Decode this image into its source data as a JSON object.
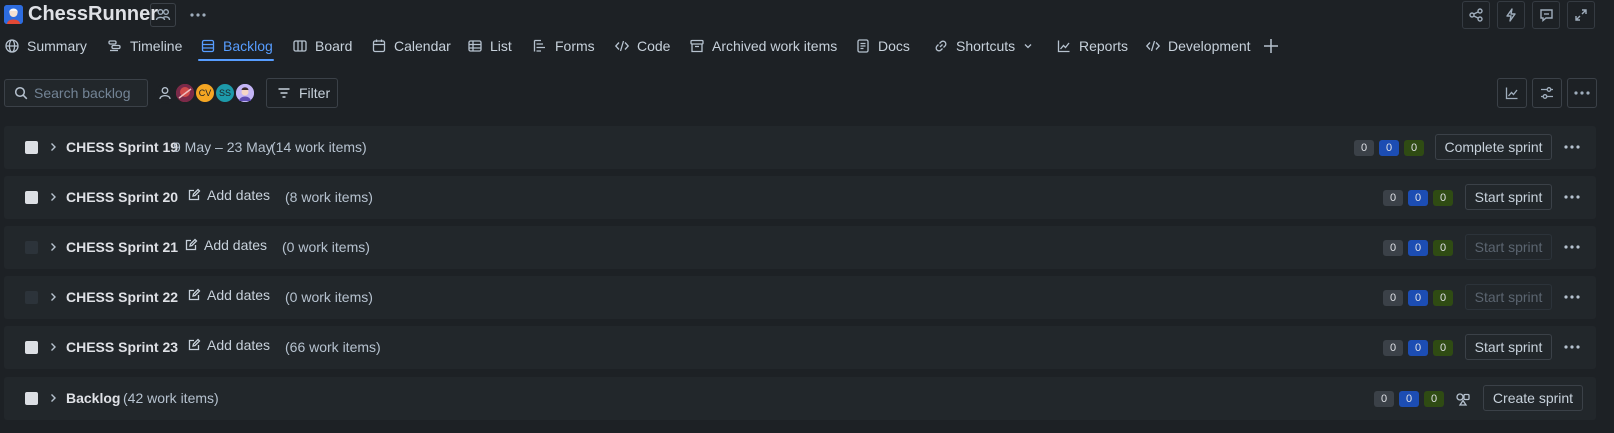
{
  "project": {
    "name": "ChessRunner"
  },
  "tabs": [
    {
      "label": "Summary",
      "icon": "globe-icon"
    },
    {
      "label": "Timeline",
      "icon": "timeline-icon"
    },
    {
      "label": "Backlog",
      "icon": "backlog-icon",
      "active": true
    },
    {
      "label": "Board",
      "icon": "board-icon"
    },
    {
      "label": "Calendar",
      "icon": "calendar-icon"
    },
    {
      "label": "List",
      "icon": "list-icon"
    },
    {
      "label": "Forms",
      "icon": "forms-icon"
    },
    {
      "label": "Code",
      "icon": "code-icon"
    },
    {
      "label": "Archived work items",
      "icon": "archive-icon"
    },
    {
      "label": "Docs",
      "icon": "docs-icon"
    },
    {
      "label": "Shortcuts",
      "icon": "link-icon"
    },
    {
      "label": "Reports",
      "icon": "chart-icon"
    },
    {
      "label": "Development",
      "icon": "code-icon"
    }
  ],
  "toolbar": {
    "search_placeholder": "Search backlog",
    "filter_label": "Filter",
    "avatars": [
      {
        "initials": "",
        "color": "#1d2125",
        "kind": "unassigned"
      },
      {
        "initials": "",
        "color": "#c9372c",
        "kind": "photo"
      },
      {
        "initials": "CV",
        "color": "#f5a623",
        "kind": "initials"
      },
      {
        "initials": "SS",
        "color": "#1d9aaa",
        "kind": "initials"
      },
      {
        "initials": "",
        "color": "#9f8fef",
        "kind": "photo"
      }
    ]
  },
  "sprints": [
    {
      "name": "CHESS Sprint 19",
      "dates": "9 May – 23 May",
      "count": "(14 work items)",
      "todo": "0",
      "progress": "0",
      "done": "0",
      "action": "Complete sprint",
      "action_enabled": true,
      "checkable": true
    },
    {
      "name": "CHESS Sprint 20",
      "add_dates": "Add dates",
      "count": "(8 work items)",
      "todo": "0",
      "progress": "0",
      "done": "0",
      "action": "Start sprint",
      "action_enabled": true,
      "checkable": true
    },
    {
      "name": "CHESS Sprint 21",
      "add_dates": "Add dates",
      "count": "(0 work items)",
      "todo": "0",
      "progress": "0",
      "done": "0",
      "action": "Start sprint",
      "action_enabled": false,
      "checkable": false
    },
    {
      "name": "CHESS Sprint 22",
      "add_dates": "Add dates",
      "count": "(0 work items)",
      "todo": "0",
      "progress": "0",
      "done": "0",
      "action": "Start sprint",
      "action_enabled": false,
      "checkable": false
    },
    {
      "name": "CHESS Sprint 23",
      "add_dates": "Add dates",
      "count": "(66 work items)",
      "todo": "0",
      "progress": "0",
      "done": "0",
      "action": "Start sprint",
      "action_enabled": true,
      "checkable": true
    }
  ],
  "backlog": {
    "name": "Backlog",
    "count": "(42 work items)",
    "todo": "0",
    "progress": "0",
    "done": "0",
    "action": "Create sprint"
  },
  "colors": {
    "accent": "#579dff",
    "background": "#1d2125",
    "row": "#22272b"
  }
}
